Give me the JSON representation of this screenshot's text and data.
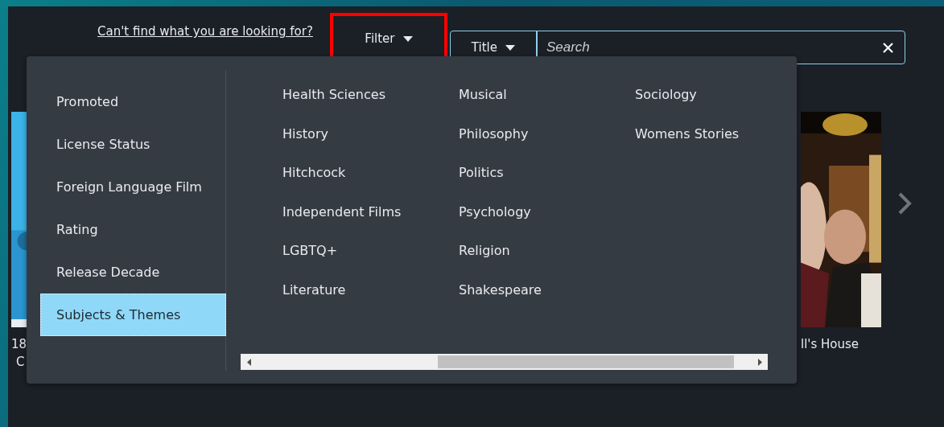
{
  "top_bar": {
    "help_link": "Can't find what you are looking for?",
    "filter_button": {
      "label": "Filter",
      "highlighted": true
    },
    "search": {
      "scope": "Title",
      "placeholder": "Search"
    }
  },
  "filter_menu": {
    "categories": [
      {
        "label": "Promoted",
        "selected": false
      },
      {
        "label": "License Status",
        "selected": false
      },
      {
        "label": "Foreign Language Film",
        "selected": false
      },
      {
        "label": "Rating",
        "selected": false
      },
      {
        "label": "Release Decade",
        "selected": false
      },
      {
        "label": "Subjects & Themes",
        "selected": true
      }
    ],
    "options": [
      [
        "Health Sciences",
        "History",
        "Hitchcock",
        "Independent Films",
        "LGBTQ+",
        "Literature"
      ],
      [
        "Musical",
        "Philosophy",
        "Politics",
        "Psychology",
        "Religion",
        "Shakespeare"
      ],
      [
        "Sociology",
        "Womens Stories"
      ]
    ]
  },
  "carousel": {
    "left_card": {
      "title_lines": [
        "18",
        "C"
      ]
    },
    "right_card": {
      "title": "ll's House"
    }
  }
}
